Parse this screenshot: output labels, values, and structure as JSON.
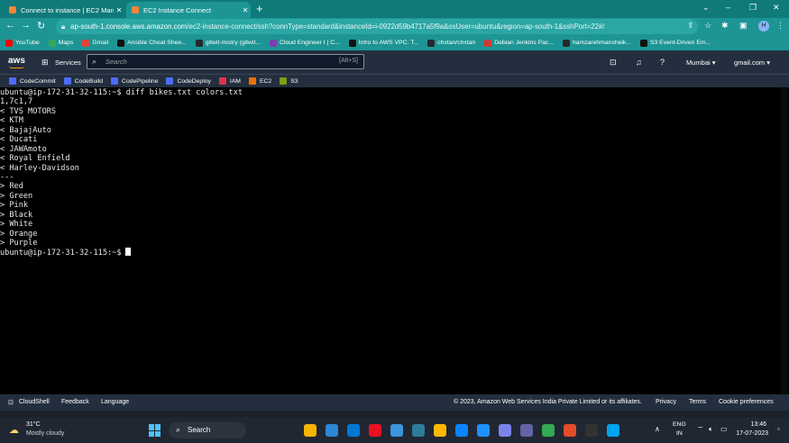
{
  "browser": {
    "tabs": [
      {
        "label": "Connect to instance | EC2 Manag",
        "favicon_color": "#f58536"
      },
      {
        "label": "EC2 Instance Connect",
        "favicon_color": "#f58536"
      }
    ],
    "new_tab": "+",
    "window_controls": {
      "minimize": "–",
      "restore": "❐",
      "close": "✕",
      "tab_search": "⌄"
    },
    "url_host": "ap-south-1.console.aws.amazon.com",
    "url_path": "/ec2-instance-connect/ssh?connType=standard&instanceId=i-0922d59b4717a5f9a&osUser=ubuntu&region=ap-south-1&sshPort=22#/",
    "avatar_initial": "H",
    "bookmarks": [
      {
        "label": "YouTube",
        "color": "#ff0000"
      },
      {
        "label": "Maps",
        "color": "#34a853"
      },
      {
        "label": "Gmail",
        "color": "#ea4335"
      },
      {
        "label": "Ansible Cheat Shee...",
        "color": "#111111"
      },
      {
        "label": "gitwit-mistry (gitwit...",
        "color": "#24292e"
      },
      {
        "label": "Cloud Engineer I | C...",
        "color": "#7b3fb5"
      },
      {
        "label": "Intro to AWS VPC. T...",
        "color": "#111111"
      },
      {
        "label": "chxtan/chxtan",
        "color": "#24292e"
      },
      {
        "label": "Debian Jenkins Pac...",
        "color": "#d33833"
      },
      {
        "label": "hamzarehmansheik...",
        "color": "#24292e"
      },
      {
        "label": "S3 Event-Driven Em...",
        "color": "#111111"
      }
    ]
  },
  "aws": {
    "logo": "aws",
    "services_label": "Services",
    "search_placeholder": "Search",
    "search_shortcut": "[Alt+S]",
    "region": "Mumbai ▾",
    "account": "gmail.com ▾",
    "favorites": [
      {
        "label": "CodeCommit",
        "color": "#4d6bfe"
      },
      {
        "label": "CodeBuild",
        "color": "#4d6bfe"
      },
      {
        "label": "CodePipeline",
        "color": "#4d6bfe"
      },
      {
        "label": "CodeDeploy",
        "color": "#4d6bfe"
      },
      {
        "label": "IAM",
        "color": "#dd344c"
      },
      {
        "label": "EC2",
        "color": "#ed7100"
      },
      {
        "label": "S3",
        "color": "#7aa116"
      }
    ],
    "footer": {
      "cloudshell": "CloudShell",
      "feedback": "Feedback",
      "language": "Language",
      "copyright": "© 2023, Amazon Web Services India Private Limited or its affiliates.",
      "privacy": "Privacy",
      "terms": "Terms",
      "cookies": "Cookie preferences"
    }
  },
  "terminal": {
    "lines": [
      "ubuntu@ip-172-31-32-115:~$ diff bikes.txt colors.txt",
      "1,7c1,7",
      "< TVS MOTORS",
      "< KTM",
      "< BajajAuto",
      "< Ducati",
      "< JAWAmoto",
      "< Royal Enfield",
      "< Harley-Davidson",
      "---",
      "> Red",
      "> Green",
      "> Pink",
      "> Black",
      "> White",
      "> Orange",
      "> Purple"
    ],
    "prompt": "ubuntu@ip-172-31-32-115:~$"
  },
  "taskbar": {
    "weather_temp": "31°C",
    "weather_desc": "Mostly cloudy",
    "search_label": "Search",
    "lang_1": "ENG",
    "lang_2": "IN",
    "time": "13:46",
    "date": "17-07-2023",
    "apps": [
      "#f4b400",
      "#2b88d8",
      "#0078d4",
      "#e81123",
      "#3a96dd",
      "#2d7d9a",
      "#ffb900",
      "#0a84ff",
      "#1e90ff",
      "#7b83eb",
      "#6264a7",
      "#34a853",
      "#e34c26",
      "#333333",
      "#00a4ef"
    ]
  }
}
